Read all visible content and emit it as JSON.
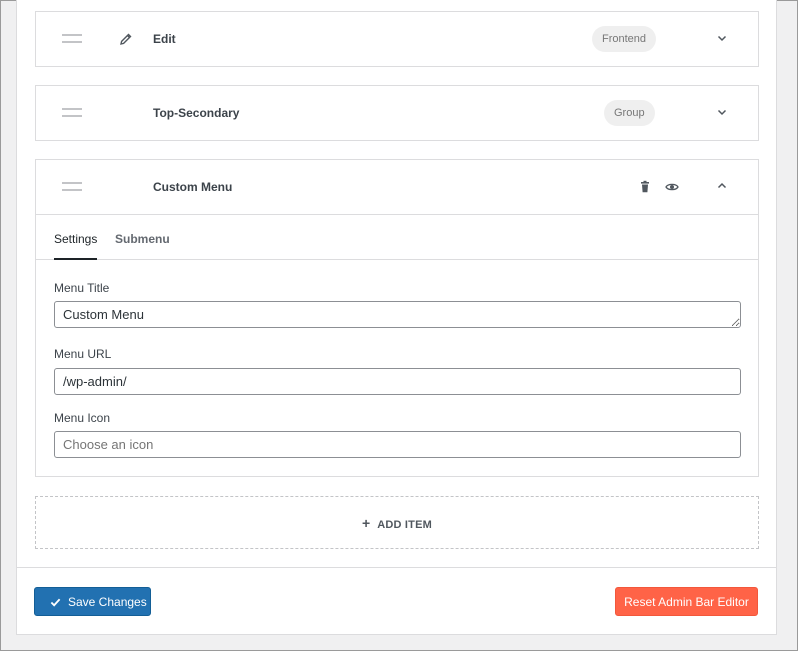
{
  "items": [
    {
      "title": "Edit",
      "badge": "Frontend"
    },
    {
      "title": "Top-Secondary",
      "badge": "Group"
    },
    {
      "title": "Custom Menu"
    }
  ],
  "tabs": {
    "settings": "Settings",
    "submenu": "Submenu"
  },
  "form": {
    "title_label": "Menu Title",
    "title_value": "Custom Menu",
    "url_label": "Menu URL",
    "url_value": "/wp-admin/",
    "icon_label": "Menu Icon",
    "icon_placeholder": "Choose an icon"
  },
  "add_item": "ADD ITEM",
  "footer": {
    "save_label": "Save Changes",
    "reset_label": "Reset Admin Bar Editor"
  },
  "colors": {
    "primary": "#2271b1",
    "danger": "#ff6347"
  },
  "icons": [
    "drag-handle-icon",
    "pencil-icon",
    "chevron-down-icon",
    "chevron-up-icon",
    "trash-icon",
    "eye-icon",
    "plus-icon",
    "checkmark-icon"
  ]
}
